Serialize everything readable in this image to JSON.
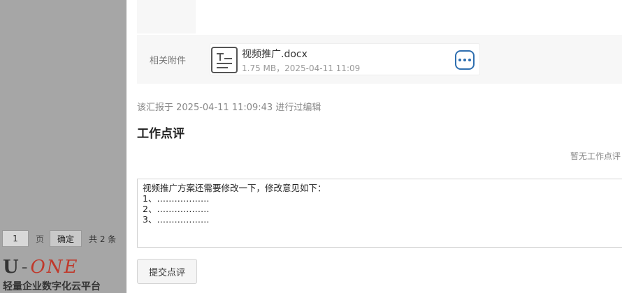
{
  "pager": {
    "page_value": "1",
    "page_unit": "页",
    "confirm_label": "确定",
    "total_label": "共 2 条"
  },
  "brand": {
    "logo_u": "U",
    "logo_dash": "-",
    "logo_one": "ONE",
    "tagline": "轻量企业数字化云平台"
  },
  "attachment": {
    "row_label": "相关附件",
    "file_name": "视频推广.docx",
    "file_meta": "1.75 MB，2025-04-11 11:09",
    "file_icon": "document-icon",
    "more_icon": "more-options-icon"
  },
  "edit_note": "该汇报于 2025-04-11 11:09:43 进行过编辑",
  "review": {
    "title": "工作点评",
    "empty_text": "暂无工作点评",
    "comment_value": "视频推广方案还需要修改一下，修改意见如下：\n1、………………\n2、………………\n3、………………",
    "submit_label": "提交点评"
  },
  "colors": {
    "accent": "#2f6fb0",
    "brand_red": "#c0392b",
    "backdrop": "#a6a6a6"
  }
}
